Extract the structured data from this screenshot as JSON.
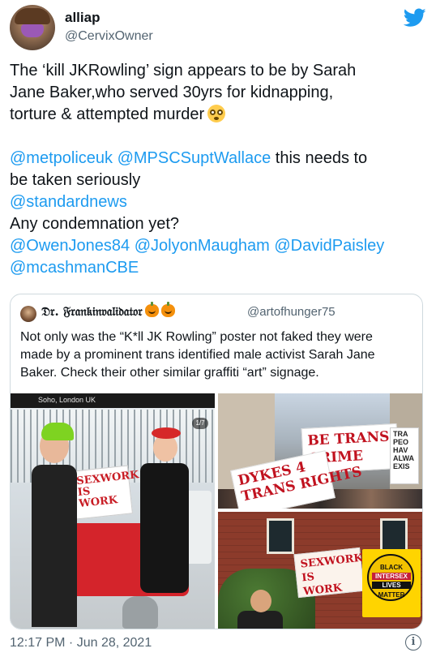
{
  "author": {
    "name": "alliap",
    "handle": "@CervixOwner"
  },
  "tweet": {
    "lines": [
      "The ‘kill JKRowling’ sign appears to be by Sarah",
      "Jane Baker,who served 30yrs for kidnapping,",
      "torture & attempted murder"
    ],
    "mention_police": "@metpoliceuk",
    "mention_supt": "@MPSCSuptWallace",
    "line4_rest": " this needs to",
    "line5": "be taken seriously",
    "mention_standard": "@standardnews",
    "line7": "Any condemnation yet?",
    "mention_owen": "@OwenJones84",
    "mention_jolyon": "@JolyonMaugham",
    "mention_david": "@DavidPaisley",
    "mention_mcashman": "@mcashmanCBE",
    "emoji": "flushed-face"
  },
  "quote": {
    "name": "𝔇𝔯. 𝔉𝔯𝔞𝔫𝔨𝔦𝔫𝔳𝔞𝔩𝔦𝔡𝔞𝔱𝔬𝔯",
    "handle": "@artofhunger75",
    "lines": [
      "Not only was the “K*ll JK Rowling” poster not faked they were",
      "made by a prominent trans identified male activist Sarah Jane",
      "Baker. Check their other similar graffiti “art” signage."
    ],
    "media": {
      "photo1_location": "Soho, London UK",
      "photo1_counter": "1/7",
      "photo1_sign": "SEXWORK\nIS\nWORK",
      "photo2_sign_main": "BE TRANS\nCRIME",
      "photo2_sign_left": "DYKES 4\nTRANS RIGHTS",
      "photo2_sign_right": "TRA\nPEO\nHAV\nALWA\nEXIS",
      "photo3_sign_left": "SEXWORK\nIS\nWORK",
      "photo3_sign_right_1": "BLACK",
      "photo3_sign_right_2": "INTERSEX",
      "photo3_sign_right_3": "LIVES",
      "photo3_sign_right_4": "MATTER"
    }
  },
  "footer": {
    "timestamp": "12:17 PM · Jun 28, 2021",
    "info_glyph": "i"
  },
  "colors": {
    "link": "#1d9bf0",
    "text": "#0f1419",
    "secondary": "#536471",
    "twitter_blue": "#1d9bf0"
  }
}
